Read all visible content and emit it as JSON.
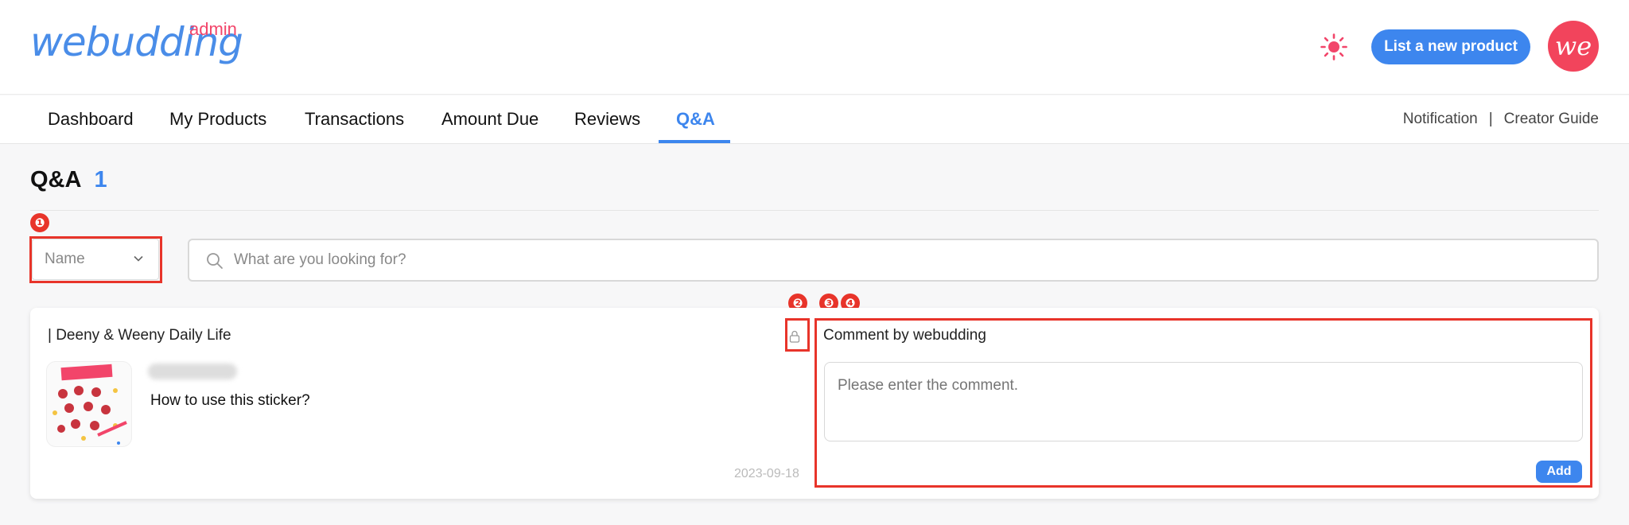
{
  "header": {
    "logo_text": "webudding",
    "logo_sup": "admin",
    "list_button": "List a new product",
    "avatar_text": "we",
    "theme_icon": "sun-icon",
    "colors": {
      "accent": "#3d86ee",
      "brand_pink": "#f2456a",
      "annotation": "#e8342a"
    }
  },
  "nav": {
    "tabs": [
      {
        "label": "Dashboard"
      },
      {
        "label": "My Products"
      },
      {
        "label": "Transactions"
      },
      {
        "label": "Amount Due"
      },
      {
        "label": "Reviews"
      },
      {
        "label": "Q&A"
      }
    ],
    "active_tab": "Q&A",
    "right": {
      "notification": "Notification",
      "separator": "|",
      "guide": "Creator Guide"
    }
  },
  "page": {
    "title": "Q&A",
    "count": "1"
  },
  "filter": {
    "select_value": "Name",
    "search_placeholder": "What are you looking for?"
  },
  "markers": [
    "❶",
    "❷",
    "❸",
    "❹"
  ],
  "qa_item": {
    "product": "| Deeny & Weeny Daily Life",
    "question": "How to use this sticker?",
    "date": "2023-09-18",
    "lock_icon": "lock-icon",
    "comment_title": "Comment by webudding",
    "comment_placeholder": "Please enter the comment.",
    "add_button": "Add"
  }
}
